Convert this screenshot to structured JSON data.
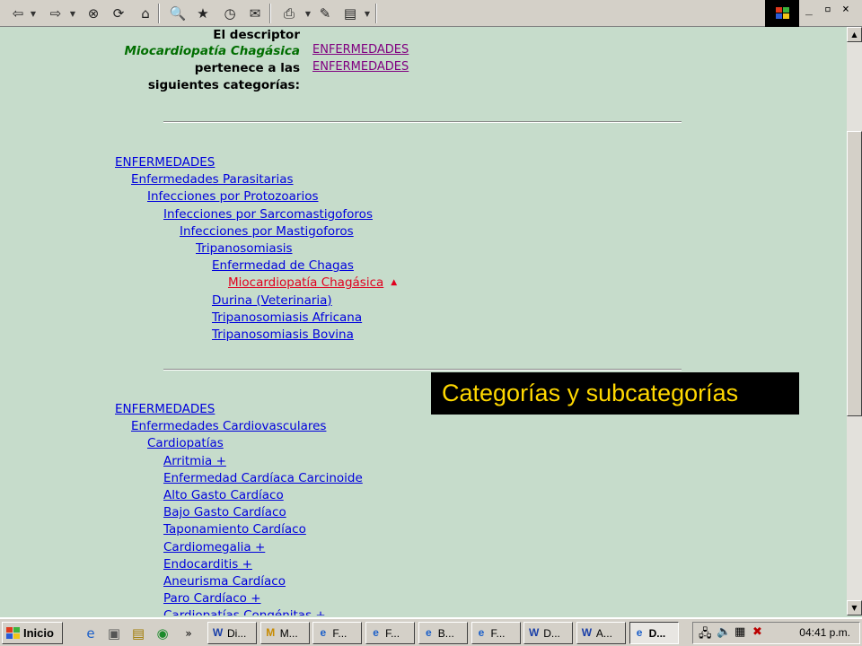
{
  "toolbar": {
    "buttons": [
      {
        "name": "back-icon",
        "glyph": "⇦"
      },
      {
        "name": "forward-icon",
        "glyph": "⇨"
      },
      {
        "name": "stop-icon",
        "glyph": "⊗"
      },
      {
        "name": "refresh-icon",
        "glyph": "⟳"
      },
      {
        "name": "home-icon",
        "glyph": "⌂"
      },
      {
        "name": "search-icon",
        "glyph": "🔍"
      },
      {
        "name": "favorites-icon",
        "glyph": "★"
      },
      {
        "name": "history-icon",
        "glyph": "◷"
      },
      {
        "name": "mail-icon",
        "glyph": "✉"
      },
      {
        "name": "print-icon",
        "glyph": "⎙"
      },
      {
        "name": "edit-icon",
        "glyph": "✎"
      },
      {
        "name": "discuss-icon",
        "glyph": "▤"
      }
    ]
  },
  "descriptor": {
    "line1": "El descriptor",
    "name": "Miocardiopatía Chagásica",
    "line3": "pertenece a las",
    "line4": "siguientes categorías:",
    "categories": [
      "ENFERMEDADES",
      "ENFERMEDADES"
    ]
  },
  "tree1": [
    {
      "label": "ENFERMEDADES",
      "level": 0
    },
    {
      "label": "Enfermedades Parasitarias",
      "level": 1
    },
    {
      "label": "Infecciones por Protozoarios",
      "level": 2
    },
    {
      "label": "Infecciones por Sarcomastigoforos",
      "level": 3
    },
    {
      "label": "Infecciones por Mastigoforos",
      "level": 4
    },
    {
      "label": "Tripanosomiasis",
      "level": 5
    },
    {
      "label": "Enfermedad de Chagas",
      "level": 6
    },
    {
      "label": "Miocardiopatía Chagásica",
      "level": 7,
      "current": true
    },
    {
      "label": "Durina (Veterinaria)",
      "level": 6
    },
    {
      "label": "Tripanosomiasis Africana",
      "level": 6
    },
    {
      "label": "Tripanosomiasis Bovina",
      "level": 6
    }
  ],
  "tree2": [
    {
      "label": "ENFERMEDADES",
      "level": 0
    },
    {
      "label": "Enfermedades Cardiovasculares",
      "level": 1
    },
    {
      "label": "Cardiopatías",
      "level": 2
    },
    {
      "label": "Arritmia +",
      "level": 3
    },
    {
      "label": "Enfermedad Cardíaca Carcinoide",
      "level": 3
    },
    {
      "label": "Alto Gasto Cardíaco",
      "level": 3
    },
    {
      "label": "Bajo Gasto Cardíaco",
      "level": 3
    },
    {
      "label": "Taponamiento Cardíaco",
      "level": 3
    },
    {
      "label": "Cardiomegalia +",
      "level": 3
    },
    {
      "label": "Endocarditis +",
      "level": 3
    },
    {
      "label": "Aneurisma Cardíaco",
      "level": 3
    },
    {
      "label": "Paro Cardíaco +",
      "level": 3
    },
    {
      "label": "Cardiopatías Congénitas +",
      "level": 3
    }
  ],
  "caption": "Categorías y subcategorías",
  "taskbar": {
    "start_label": "Inicio",
    "tasks": [
      {
        "icon": "W",
        "label": "Di..."
      },
      {
        "icon": "M",
        "label": "M..."
      },
      {
        "icon": "e",
        "label": "F..."
      },
      {
        "icon": "e",
        "label": "F..."
      },
      {
        "icon": "e",
        "label": "B..."
      },
      {
        "icon": "e",
        "label": "F..."
      },
      {
        "icon": "W",
        "label": "D..."
      },
      {
        "icon": "W",
        "label": "A..."
      },
      {
        "icon": "e",
        "label": "D...",
        "active": true
      }
    ],
    "clock": "04:41 p.m."
  }
}
